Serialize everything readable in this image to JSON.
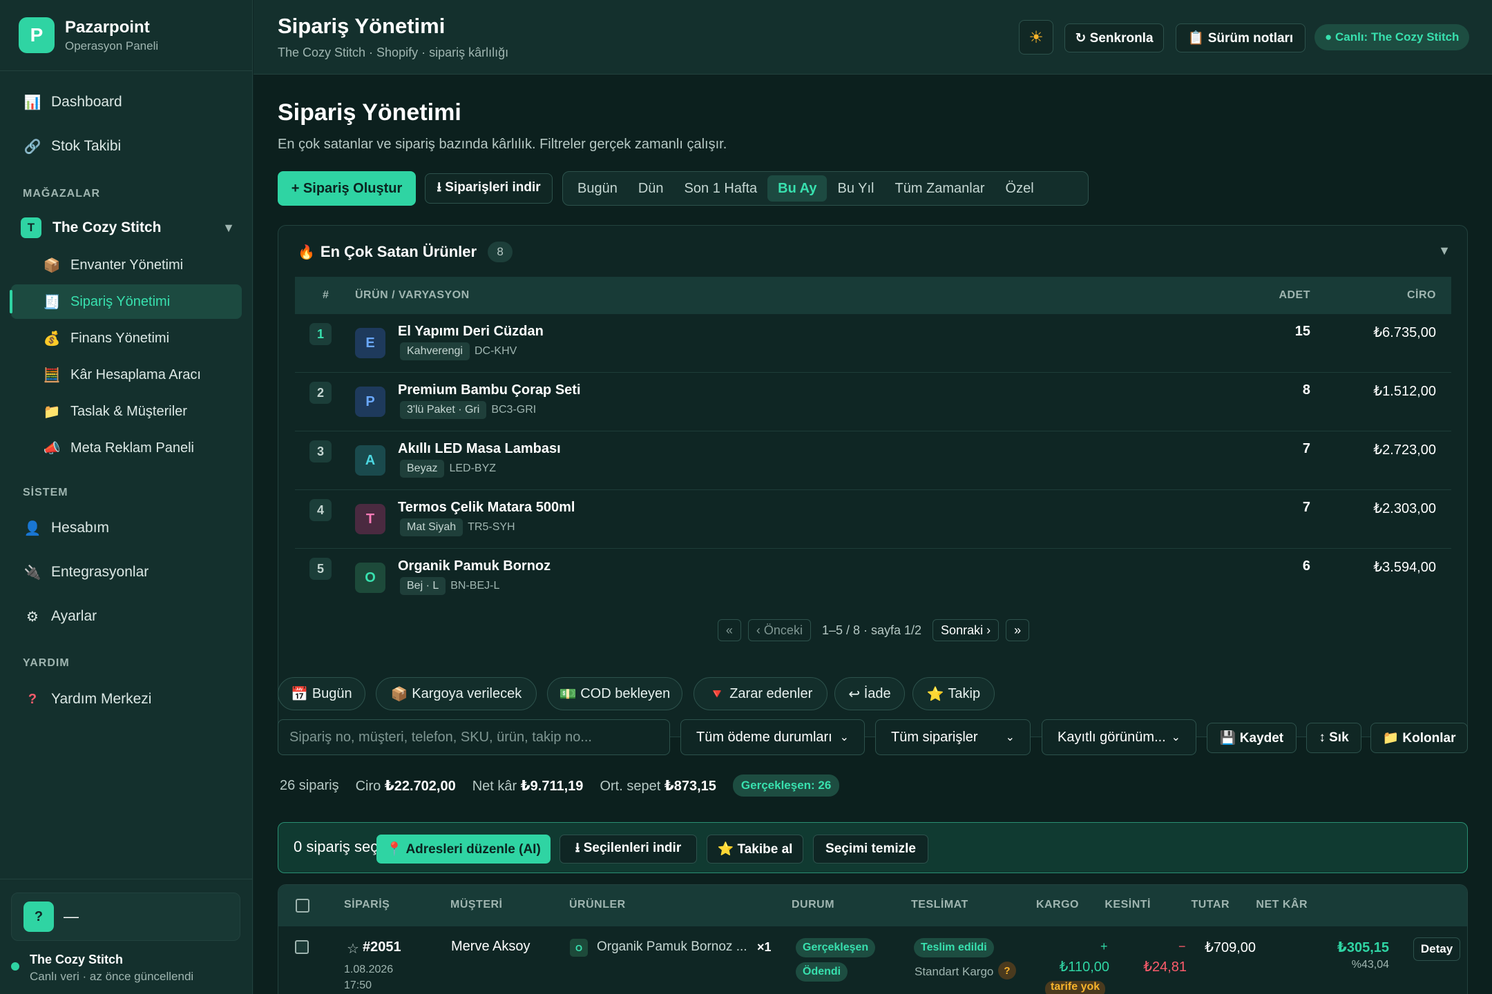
{
  "brand": {
    "title": "Pazarpoint",
    "subtitle": "Operasyon Paneli",
    "logo_letter": "P"
  },
  "colors": {
    "accent": "#2fd4a3",
    "bg": "#0f2624",
    "sidebar": "#14302d",
    "danger": "#ff5c6c"
  },
  "sidebar": {
    "main_items": [
      {
        "label": "Dashboard",
        "icon": "chart-icon"
      },
      {
        "label": "Stok Takibi",
        "icon": "link-icon"
      }
    ],
    "stores_label": "MAĞAZALAR",
    "store": {
      "badge": "T",
      "name": "The Cozy Stitch"
    },
    "store_items": [
      {
        "label": "Envanter Yönetimi",
        "icon": "box-icon"
      },
      {
        "label": "Sipariş Yönetimi",
        "icon": "receipt-icon",
        "active": true
      },
      {
        "label": "Finans Yönetimi",
        "icon": "money-bag-icon"
      },
      {
        "label": "Kâr Hesaplama Aracı",
        "icon": "abacus-icon"
      },
      {
        "label": "Taslak & Müşteriler",
        "icon": "folder-icon"
      },
      {
        "label": "Meta Reklam Paneli",
        "icon": "megaphone-icon"
      }
    ],
    "system_label": "SİSTEM",
    "system_items": [
      {
        "label": "Hesabım",
        "icon": "user-icon"
      },
      {
        "label": "Entegrasyonlar",
        "icon": "plug-icon"
      },
      {
        "label": "Ayarlar",
        "icon": "gear-icon"
      }
    ],
    "help_label": "YARDIM",
    "help_items": [
      {
        "label": "Yardım Merkezi",
        "icon": "question-icon"
      }
    ],
    "user": {
      "avatar": "?",
      "name": "—"
    },
    "footer_store": "The Cozy Stitch",
    "footer_note": "Canlı veri · az önce güncellendi"
  },
  "topbar": {
    "title": "Sipariş Yönetimi",
    "subtitle": "The Cozy Stitch · Shopify · sipariş kârlılığı",
    "theme_icon": "☀",
    "sync": "↻ Senkronla",
    "notes": "📋 Sürüm notları",
    "live": "● Canlı: The Cozy Stitch"
  },
  "page": {
    "title": "Sipariş Yönetimi",
    "desc": "En çok satanlar ve sipariş bazında kârlılık. Filtreler gerçek zamanlı çalışır.",
    "create": "+ Sipariş Oluştur",
    "download": "⭳ Siparişleri indir",
    "ranges": [
      "Bugün",
      "Dün",
      "Son 1 Hafta",
      "Bu Ay",
      "Bu Yıl",
      "Tüm Zamanlar",
      "Özel"
    ],
    "active_range": "Bu Ay"
  },
  "top_products": {
    "title": "En Çok Satan Ürünler",
    "count": "8",
    "columns": {
      "rank": "#",
      "product": "ÜRÜN / VARYASYON",
      "qty": "ADET",
      "revenue": "CİRO"
    },
    "rows": [
      {
        "rank": "1",
        "letter": "E",
        "name": "El Yapımı Deri Cüzdan",
        "variant": "Kahverengi",
        "sku": "DC-KHV",
        "qty": "15",
        "revenue": "₺6.735,00"
      },
      {
        "rank": "2",
        "letter": "P",
        "name": "Premium Bambu Çorap Seti",
        "variant": "3'lü Paket · Gri",
        "sku": "BC3-GRI",
        "qty": "8",
        "revenue": "₺1.512,00"
      },
      {
        "rank": "3",
        "letter": "A",
        "name": "Akıllı LED Masa Lambası",
        "variant": "Beyaz",
        "sku": "LED-BYZ",
        "qty": "7",
        "revenue": "₺2.723,00"
      },
      {
        "rank": "4",
        "letter": "T",
        "name": "Termos Çelik Matara 500ml",
        "variant": "Mat Siyah",
        "sku": "TR5-SYH",
        "qty": "7",
        "revenue": "₺2.303,00"
      },
      {
        "rank": "5",
        "letter": "O",
        "name": "Organik Pamuk Bornoz",
        "variant": "Bej · L",
        "sku": "BN-BEJ-L",
        "qty": "6",
        "revenue": "₺3.594,00"
      }
    ],
    "pager": {
      "first": "«",
      "prev": "‹ Önceki",
      "info": "1–5 / 8 · sayfa 1/2",
      "next": "Sonraki ›",
      "last": "»"
    }
  },
  "quick_filters": [
    {
      "label": "Bugün",
      "icon": "calendar-icon",
      "glyph": "📅"
    },
    {
      "label": "Kargoya verilecek",
      "icon": "package-icon",
      "glyph": "📦"
    },
    {
      "label": "COD bekleyen",
      "icon": "cash-icon",
      "glyph": "💵"
    },
    {
      "label": "Zarar edenler",
      "icon": "down-triangle-icon",
      "glyph": "🔻"
    },
    {
      "label": "İade",
      "icon": "return-icon",
      "glyph": "↩"
    },
    {
      "label": "Takip",
      "icon": "star-icon",
      "glyph": "⭐"
    }
  ],
  "filters": {
    "search_placeholder": "Sipariş no, müşteri, telefon, SKU, ürün, takip no...",
    "payment": "Tüm ödeme durumları",
    "orders": "Tüm siparişler",
    "saved_view": "Kayıtlı görünüm...",
    "save": "💾 Kaydet",
    "dense": "↕ Sık",
    "columns": "📁 Kolonlar"
  },
  "stats": {
    "count": "26 sipariş",
    "revenue_label": "Ciro",
    "revenue": "₺22.702,00",
    "net_label": "Net kâr",
    "net": "₺9.711,19",
    "avg_label": "Ort. sepet",
    "avg": "₺873,15",
    "realized": "Gerçekleşen: 26"
  },
  "selection": {
    "text": "0 sipariş seçili",
    "ai": "📍 Adresleri düzenle (AI)",
    "download": "⭳ Seçilenleri indir",
    "follow": "⭐ Takibe al",
    "clear": "Seçimi temizle"
  },
  "orders": {
    "columns": {
      "order": "SİPARİŞ",
      "customer": "MÜŞTERİ",
      "products": "ÜRÜNLER",
      "status": "DURUM",
      "delivery": "TESLİMAT",
      "shipping": "KARGO",
      "deduction": "KESİNTİ",
      "total": "TUTAR",
      "net": "NET KÂR"
    },
    "rows": [
      {
        "star": "☆",
        "id": "#2051",
        "date": "1.08.2026",
        "time": "17:50",
        "customer": "Merve Aksoy",
        "product_letter": "O",
        "product": "Organik Pamuk Bornoz ...",
        "qty": "×1",
        "status": "Gerçekleşen",
        "payment": "Ödendi",
        "delivery": "Teslim edildi",
        "carrier": "Standart Kargo",
        "carrier_help": "?",
        "shipping_sign": "+",
        "shipping": "₺110,00",
        "shipping_note": "tarife yok",
        "deduction_sign": "−",
        "deduction": "₺24,81",
        "total": "₺709,00",
        "net": "₺305,15",
        "margin": "%43,04",
        "detail": "Detay"
      }
    ]
  }
}
